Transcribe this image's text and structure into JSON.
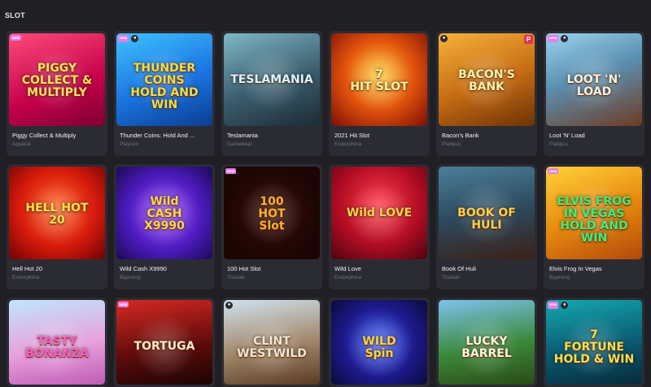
{
  "section": {
    "title": "SLOT"
  },
  "games": [
    {
      "name": "Piggy Collect & Multiply",
      "provider": "Apparat",
      "art": "PIGGY\nCOLLECT &\nMULTIPLY",
      "badge_new": "NEW",
      "badge_circle": false,
      "badge_p": "",
      "bg": "linear-gradient(160deg,#ff4b7a,#c4004a 60%,#7d0030)",
      "title_color": "#ffe25a"
    },
    {
      "name": "Thunder Coins: Hold And ...",
      "provider": "Playson",
      "art": "THUNDER\nCOINS\nHOLD AND WIN",
      "badge_new": "NEW",
      "badge_circle": true,
      "badge_p": "",
      "bg": "linear-gradient(160deg,#3fc3ff,#1a74e0 55%,#0b3d91)",
      "title_color": "#ffd93b"
    },
    {
      "name": "Teslamania",
      "provider": "Gamebeat",
      "art": "TESLAMANIA",
      "badge_new": "",
      "badge_circle": false,
      "badge_p": "",
      "bg": "linear-gradient(160deg,#7fb7c7,#3b5d6e 55%,#1b2b34)",
      "title_color": "#d8f4ff"
    },
    {
      "name": "2021 Hit Slot",
      "provider": "Endorphina",
      "art": "7\nHIT SLOT",
      "badge_new": "",
      "badge_circle": false,
      "badge_p": "",
      "bg": "radial-gradient(circle at 50% 45%,#ffcf3a,#e2520d 50%,#7a0e05)",
      "title_color": "#fff3a0"
    },
    {
      "name": "Bacon's Bank",
      "provider": "Platipus",
      "art": "BACON'S\nBANK",
      "badge_new": "",
      "badge_circle": true,
      "badge_p": "P",
      "bg": "linear-gradient(160deg,#f7b23b,#c46a12 55%,#6b3306)",
      "title_color": "#fff1a8"
    },
    {
      "name": "Loot 'N' Load",
      "provider": "Platipus",
      "art": "LOOT 'N' LOAD",
      "badge_new": "NEW",
      "badge_circle": true,
      "badge_p": "",
      "bg": "linear-gradient(160deg,#9ad4f0,#5b8fb0 45%,#6e3b22)",
      "title_color": "#f7f1dd"
    },
    {
      "name": "Hell Hot 20",
      "provider": "Endorphina",
      "art": "HELL HOT\n20",
      "badge_new": "",
      "badge_circle": false,
      "badge_p": "",
      "bg": "radial-gradient(circle at 50% 45%,#ff6a2b,#d61a0c 55%,#6e0303)",
      "title_color": "#ffe14a"
    },
    {
      "name": "Wild Cash X9990",
      "provider": "Bgaming",
      "art": "Wild\nCASH\nX9990",
      "badge_new": "",
      "badge_circle": false,
      "badge_p": "",
      "bg": "radial-gradient(circle at 50% 50%,#a65bff,#4d1bbf 55%,#1b0a55)",
      "title_color": "#ffd54a"
    },
    {
      "name": "100 Hot Slot",
      "provider": "Truelab",
      "art": "100\nHOT\nSlot",
      "badge_new": "NEW",
      "badge_circle": false,
      "badge_p": "",
      "bg": "radial-gradient(circle at 50% 50%,#3a0e0a,#1c0503 70%)",
      "title_color": "#ffb12a"
    },
    {
      "name": "Wild Love",
      "provider": "Endorphina",
      "art": "Wild LOVE",
      "badge_new": "",
      "badge_circle": false,
      "badge_p": "",
      "bg": "radial-gradient(circle at 50% 40%,#ff3a4a,#b30d24 55%,#4c0411)",
      "title_color": "#ffd24a"
    },
    {
      "name": "Book Of Huli",
      "provider": "Truelab",
      "art": "BOOK OF HULI",
      "badge_new": "",
      "badge_circle": false,
      "badge_p": "",
      "bg": "linear-gradient(170deg,#4b7f9a,#2c4a5e 50%,#3b2016)",
      "title_color": "#ffcf4a"
    },
    {
      "name": "Elvis Frog In Vegas",
      "provider": "Bgaming",
      "art": "ELVIS FROG\nIN VEGAS\nHOLD AND WIN",
      "badge_new": "NEW",
      "badge_circle": false,
      "badge_p": "",
      "bg": "linear-gradient(160deg,#ffd23a,#e98c10 50%,#b3480a)",
      "title_color": "#3df07a"
    },
    {
      "name": "",
      "provider": "",
      "art": "TASTY\nBONANZA",
      "badge_new": "",
      "badge_circle": false,
      "badge_p": "",
      "bg": "linear-gradient(170deg,#bfe6ff,#e7a2dc 55%,#c05bb6)",
      "title_color": "#ff5fc0"
    },
    {
      "name": "",
      "provider": "",
      "art": "TORTUGA",
      "badge_new": "NEW",
      "badge_circle": false,
      "badge_p": "",
      "bg": "linear-gradient(170deg,#d62a22,#5a0a0a 60%,#1a0505)",
      "title_color": "#ffe9c4"
    },
    {
      "name": "",
      "provider": "",
      "art": "CLINT\nWESTWILD",
      "badge_new": "",
      "badge_circle": true,
      "badge_p": "",
      "bg": "linear-gradient(170deg,#cfe3ef,#a3876a 55%,#5a3b22)",
      "title_color": "#f2e6d0"
    },
    {
      "name": "",
      "provider": "",
      "art": "WILD\nSpin",
      "badge_new": "",
      "badge_circle": false,
      "badge_p": "",
      "bg": "radial-gradient(circle at 50% 50%,#4b6bff,#1d1a8c 55%,#0b0a3a)",
      "title_color": "#ffd33a"
    },
    {
      "name": "",
      "provider": "",
      "art": "LUCKY\nBARREL",
      "badge_new": "",
      "badge_circle": false,
      "badge_p": "",
      "bg": "linear-gradient(170deg,#7ec2f0,#3b8a3a 55%,#2a4a16)",
      "title_color": "#fff6d8"
    },
    {
      "name": "",
      "provider": "",
      "art": "7\nFORTUNE\nHOLD & WIN",
      "badge_new": "NEW",
      "badge_circle": true,
      "badge_p": "",
      "bg": "linear-gradient(170deg,#14a8b0,#0a5b72 55%,#082a3c)",
      "title_color": "#ffdf4a"
    }
  ]
}
